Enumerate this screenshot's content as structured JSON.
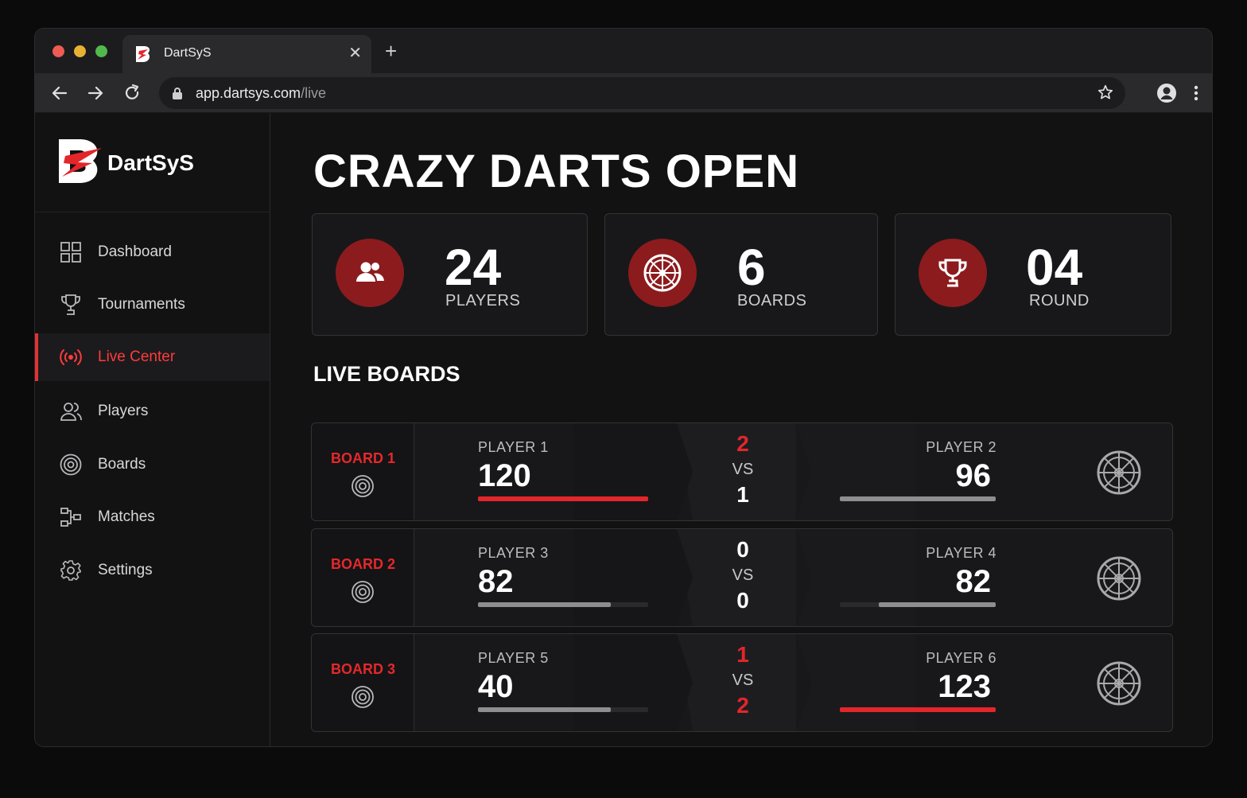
{
  "browser": {
    "tab_title": "DartSyS",
    "tab_close": "✕",
    "new_tab": "+",
    "url_host": "app.dartsys.com",
    "url_path": "/live"
  },
  "brand": {
    "name": "DartSyS"
  },
  "sidebar": {
    "items": [
      {
        "label": "Dashboard",
        "icon": "dashboard-icon"
      },
      {
        "label": "Tournaments",
        "icon": "trophy-icon"
      },
      {
        "label": "Live Center",
        "icon": "broadcast-icon",
        "active": true
      },
      {
        "label": "Players",
        "icon": "users-icon"
      },
      {
        "label": "Boards",
        "icon": "target-icon"
      },
      {
        "label": "Matches",
        "icon": "bracket-icon"
      },
      {
        "label": "Settings",
        "icon": "gear-icon"
      }
    ]
  },
  "main": {
    "title": "CRAZY DARTS OPEN",
    "stats": [
      {
        "value": "24",
        "label": "PLAYERS",
        "icon": "users-icon"
      },
      {
        "value": "6",
        "label": "BOARDS",
        "icon": "dartboard-icon"
      },
      {
        "value": "04",
        "label": "ROUND",
        "icon": "trophy-icon"
      }
    ],
    "live_boards_title": "LIVE BOARDS",
    "vs_label": "VS",
    "boards": [
      {
        "label": "BOARD 1",
        "left": {
          "name": "PLAYER 1",
          "score": "120",
          "bar_fraction": 1.0,
          "bar_color": "#e3262a"
        },
        "right": {
          "name": "PLAYER 2",
          "score": "96",
          "bar_fraction": 1.0,
          "bar_color": "#8e8e90"
        },
        "legs_top": "2",
        "legs_top_color": "#e3262a",
        "legs_bottom": "1",
        "legs_bottom_color": "#ffffff"
      },
      {
        "label": "BOARD 2",
        "left": {
          "name": "PLAYER 3",
          "score": "82",
          "bar_fraction": 0.78,
          "bar_color": "#8e8e90"
        },
        "right": {
          "name": "PLAYER 4",
          "score": "82",
          "bar_fraction": 0.75,
          "bar_color": "#8e8e90"
        },
        "legs_top": "0",
        "legs_top_color": "#ffffff",
        "legs_bottom": "0",
        "legs_bottom_color": "#ffffff"
      },
      {
        "label": "BOARD 3",
        "left": {
          "name": "PLAYER 5",
          "score": "40",
          "bar_fraction": 0.78,
          "bar_color": "#8e8e90"
        },
        "right": {
          "name": "PLAYER 6",
          "score": "123",
          "bar_fraction": 1.0,
          "bar_color": "#e3262a"
        },
        "legs_top": "1",
        "legs_top_color": "#e3262a",
        "legs_bottom": "2",
        "legs_bottom_color": "#e3262a"
      }
    ]
  },
  "colors": {
    "accent": "#e3262a",
    "stat_icon_bg": "#8c1b1e",
    "background": "#121213"
  }
}
